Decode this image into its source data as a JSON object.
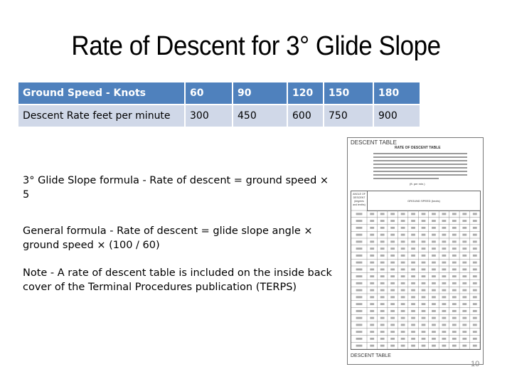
{
  "slide": {
    "title": "Rate of Descent for 3° Glide Slope",
    "page_number": "10"
  },
  "speed_table": {
    "header": [
      "Ground Speed - Knots",
      "60",
      "90",
      "120",
      "150",
      "180"
    ],
    "row": [
      "Descent Rate feet per minute",
      "300",
      "450",
      "600",
      "750",
      "900"
    ],
    "colors": {
      "header_bg": "#4f81bd",
      "row_bg": "#d0d8e8"
    }
  },
  "body": {
    "paragraph_1": "3° Glide Slope formula - Rate of descent = ground speed × 5",
    "paragraph_2": "General formula - Rate of descent = glide slope angle × ground speed × (100 / 60)",
    "paragraph_3": "Note - A rate of descent table is included on the inside back cover of the Terminal Procedures publication (TERPS)"
  },
  "descent_table_image": {
    "heading": "DESCENT TABLE",
    "subheading": "RATE OF DESCENT TABLE",
    "units_note": "(ft. per min.)",
    "column_group_label": "GROUND SPEED (knots)",
    "row_header_label": "ANGLE OF DESCENT (degrees and tenths)",
    "footer": "DESCENT TABLE"
  }
}
